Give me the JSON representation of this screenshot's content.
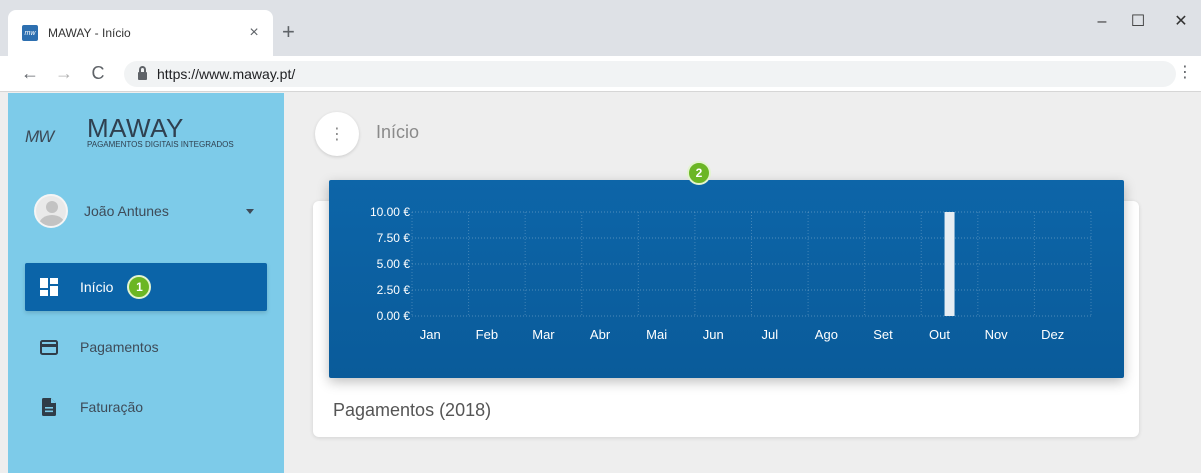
{
  "browser": {
    "tab_title": "MAWAY - Início",
    "tab_close": "×",
    "new_tab": "+",
    "url": "https://www.maway.pt/",
    "minimize": "–",
    "maximize": "☐",
    "close": "✕",
    "back": "←",
    "forward": "→",
    "reload": "C",
    "menu": "⋮",
    "favicon_text": "mw"
  },
  "sidebar": {
    "logo_mark": "MW",
    "brand": "MAWAY",
    "tagline": "PAGAMENTOS DIGITAIS INTEGRADOS",
    "user_name": "João Antunes",
    "items": [
      {
        "label": "Início",
        "icon": "dashboard-icon",
        "active": true,
        "badge": "1"
      },
      {
        "label": "Pagamentos",
        "icon": "credit-card-icon",
        "active": false
      },
      {
        "label": "Faturação",
        "icon": "document-icon",
        "active": false
      }
    ]
  },
  "main": {
    "menu_icon": "⋮",
    "page_title": "Início",
    "card_title": "Pagamentos (2018)",
    "chart_badge": "2"
  },
  "colors": {
    "sidebar_bg": "#7dcbe9",
    "active_item": "#0b64a8",
    "chart_bg": "#0b61a3",
    "badge_green": "#6bb624"
  },
  "chart_data": {
    "type": "bar",
    "title": "Pagamentos (2018)",
    "categories": [
      "Jan",
      "Feb",
      "Mar",
      "Abr",
      "Mai",
      "Jun",
      "Jul",
      "Ago",
      "Set",
      "Out",
      "Nov",
      "Dez"
    ],
    "values": [
      0,
      0,
      0,
      0,
      0,
      0,
      0,
      0,
      0,
      10,
      0,
      0
    ],
    "y_ticks": [
      "0.00 €",
      "2.50 €",
      "5.00 €",
      "7.50 €",
      "10.00 €"
    ],
    "ylim": [
      0,
      10
    ],
    "grid": true,
    "xlabel": "",
    "ylabel": ""
  }
}
